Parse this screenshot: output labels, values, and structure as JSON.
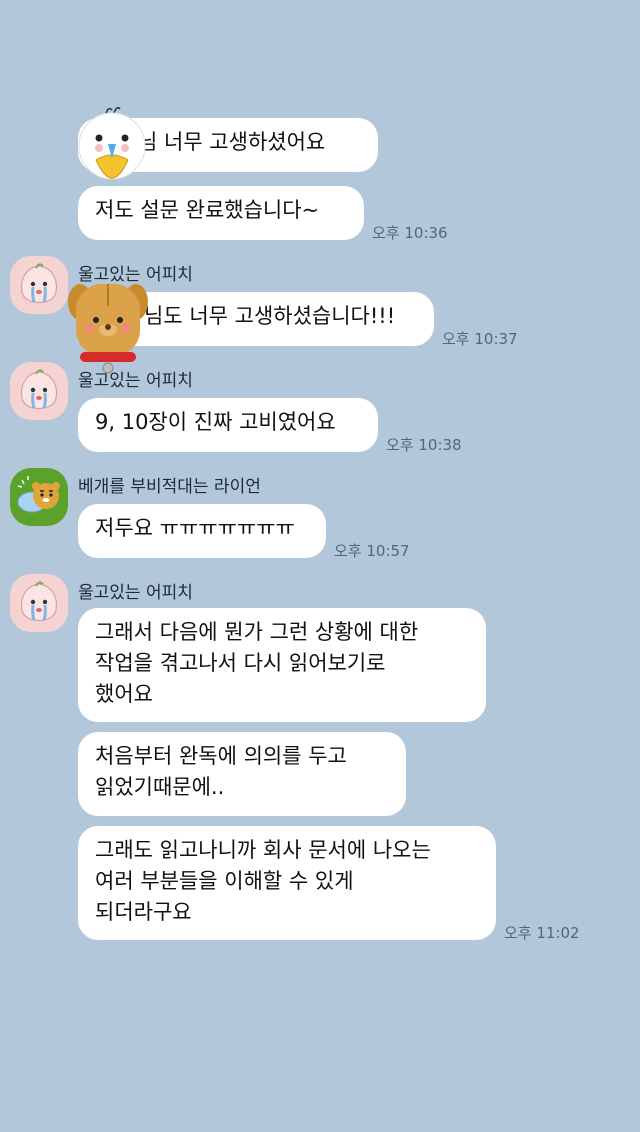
{
  "colors": {
    "background": "#b2c7da",
    "bubble": "#ffffff",
    "text": "#111111",
    "timestamp": "#556677",
    "apeach_avatar_bg": "#f5d3d3",
    "ryan_avatar_bg": "#5ca22a"
  },
  "messages": [
    {
      "text": "님 너무 고생하셨어요"
    },
    {
      "text": "저도 설문 완료했습니다~",
      "time": "오후 10:36"
    },
    {
      "sender": "울고있는 어피치",
      "text": "님도 너무 고생하셨습니다!!!",
      "time": "오후 10:37"
    },
    {
      "sender": "울고있는 어피치",
      "text": "9, 10장이 진짜 고비였어요",
      "time": "오후 10:38"
    },
    {
      "sender": "베개를 부비적대는 라이언",
      "text": "저두요 ㅠㅠㅠㅠㅠㅠㅠ",
      "time": "오후 10:57"
    },
    {
      "sender": "울고있는 어피치",
      "text": "그래서 다음에 뭔가 그런 상황에 대한\n작업을 겪고나서 다시 읽어보기로\n했어요"
    },
    {
      "text": "처음부터 완독에 의의를 두고\n읽었기때문에.."
    },
    {
      "text": "그래도 읽고나니까 회사 문서에 나오는\n여러 부분들을 이해할 수 있게\n되더라구요",
      "time": "오후 11:02"
    }
  ],
  "avatars": {
    "apeach": "crying-apeach-avatar-icon",
    "ryan": "pillow-ryan-avatar-icon"
  },
  "stickers": [
    "chick-profile-sticker-icon",
    "dog-profile-sticker-icon"
  ]
}
